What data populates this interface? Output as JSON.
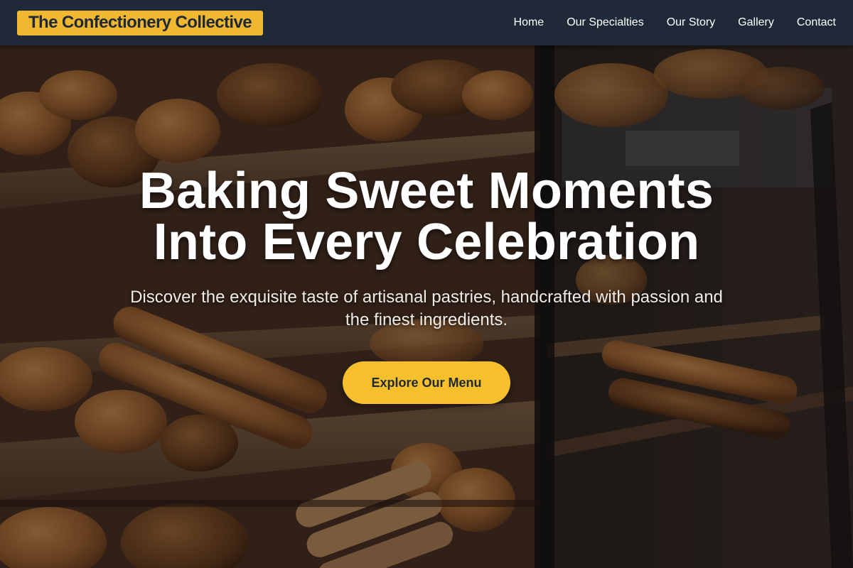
{
  "header": {
    "logo_text": "The Confectionery Collective",
    "nav": [
      "Home",
      "Our Specialties",
      "Our Story",
      "Gallery",
      "Contact"
    ]
  },
  "hero": {
    "title_line1": "Baking Sweet Moments",
    "title_line2": "Into Every Celebration",
    "subtitle": "Discover the exquisite taste of artisanal pastries, handcrafted with passion and the finest ingredients.",
    "cta_label": "Explore Our Menu",
    "background_image": "bakery display case with breads, pretzels and baguettes"
  },
  "colors": {
    "navbar": "#1f2937",
    "logo_bg": "#f0b830",
    "cta_bg": "#f6c02d",
    "text_light": "#ffffff"
  }
}
